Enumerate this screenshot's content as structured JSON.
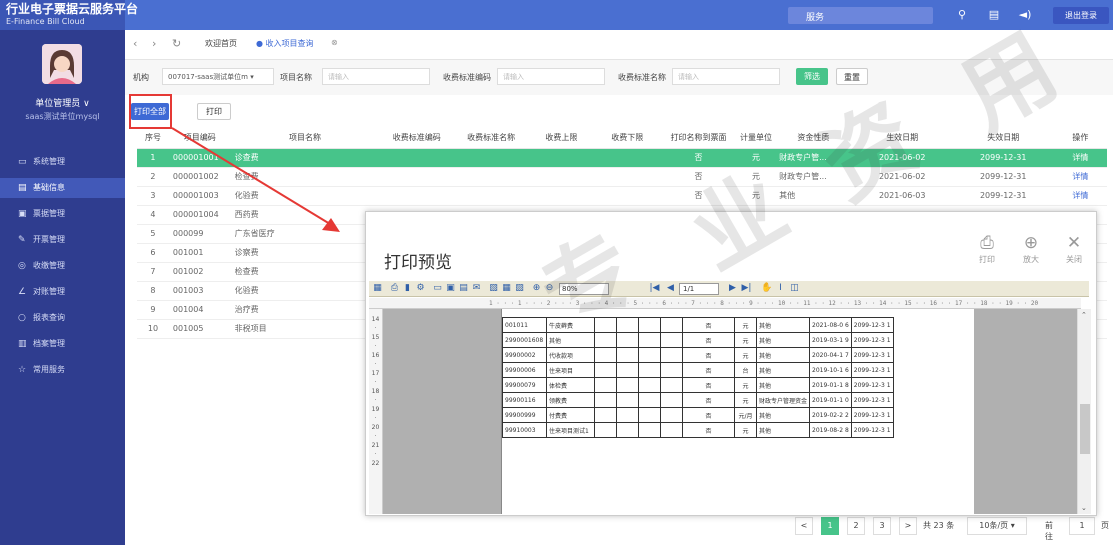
{
  "header": {
    "title": "行业电子票据云服务平台",
    "subtitle": "E-Finance Bill Cloud",
    "service_label": "服务",
    "logout": "退出登录"
  },
  "user": {
    "name": "单位管理员 ∨",
    "org": "saas测试单位mysql"
  },
  "menu": [
    {
      "icon": "▭",
      "label": "系统管理"
    },
    {
      "icon": "▤",
      "label": "基础信息"
    },
    {
      "icon": "▣",
      "label": "票据管理"
    },
    {
      "icon": "✎",
      "label": "开票管理"
    },
    {
      "icon": "◎",
      "label": "收缴管理"
    },
    {
      "icon": "∠",
      "label": "对账管理"
    },
    {
      "icon": "○",
      "label": "报表查询"
    },
    {
      "icon": "▥",
      "label": "档案管理"
    },
    {
      "icon": "☆",
      "label": "常用服务"
    }
  ],
  "tabs": {
    "home": "欢迎首页",
    "current": "● 收入项目查询",
    "close": "⊗"
  },
  "filters": {
    "org_label": "机构",
    "org_value": "007017-saas测试单位m",
    "org_arrow": "▾",
    "name_label": "项目名称",
    "name_ph": "请输入",
    "code_label": "收费标准编码",
    "code_ph": "请输入",
    "std_label": "收费标准名称",
    "std_ph": "请输入",
    "search": "筛选",
    "reset": "重置"
  },
  "actions": {
    "print_all": "打印全部",
    "print": "打印"
  },
  "table": {
    "headers": [
      "序号",
      "项目编码",
      "项目名称",
      "收费标准编码",
      "收费标准名称",
      "收费上限",
      "收费下限",
      "打印名称到票面",
      "计量单位",
      "资金性质",
      "生效日期",
      "失效日期",
      "操作"
    ],
    "rows": [
      [
        "1",
        "000001001",
        "诊查费",
        "",
        "",
        "",
        "",
        "否",
        "元",
        "财政专户管...",
        "2021-06-02",
        "2099-12-31",
        "详情"
      ],
      [
        "2",
        "000001002",
        "检查费",
        "",
        "",
        "",
        "",
        "否",
        "元",
        "财政专户管...",
        "2021-06-02",
        "2099-12-31",
        "详情"
      ],
      [
        "3",
        "000001003",
        "化验费",
        "",
        "",
        "",
        "",
        "否",
        "元",
        "其他",
        "2021-06-03",
        "2099-12-31",
        "详情"
      ],
      [
        "4",
        "000001004",
        "西药费",
        "",
        "",
        "",
        "",
        "",
        "",
        "",
        "",
        "",
        ""
      ],
      [
        "5",
        "000099",
        "广东省医疗",
        "",
        "",
        "",
        "",
        "",
        "",
        "",
        "",
        "",
        ""
      ],
      [
        "6",
        "001001",
        "诊察费",
        "",
        "",
        "",
        "",
        "",
        "",
        "",
        "",
        "",
        ""
      ],
      [
        "7",
        "001002",
        "检查费",
        "",
        "",
        "",
        "",
        "",
        "",
        "",
        "",
        "",
        ""
      ],
      [
        "8",
        "001003",
        "化验费",
        "",
        "",
        "",
        "",
        "",
        "",
        "",
        "",
        "",
        ""
      ],
      [
        "9",
        "001004",
        "治疗费",
        "",
        "",
        "",
        "",
        "",
        "",
        "",
        "",
        "",
        ""
      ],
      [
        "10",
        "001005",
        "非税项目",
        "",
        "",
        "",
        "",
        "",
        "",
        "",
        "",
        "",
        ""
      ]
    ]
  },
  "modal": {
    "title": "打印预览",
    "print": "打印",
    "zoom": "放大",
    "close": "关闭",
    "zoom_value": "80%",
    "page": "1/1",
    "ruler": "1 · · · 1 · · · 2 · · · 3 · · · 4 · · · 5 · · · 6 · · · 7 · · · 8 · · · 9 · · · 10 · · 11 · · 12 · · 13 · · 14 · · 15 · · 16 · · 17 · · 18 · · 19 · · 20",
    "vruler": [
      "14",
      "·",
      "15",
      "·",
      "16",
      "·",
      "17",
      "·",
      "18",
      "·",
      "19",
      "·",
      "20",
      "·",
      "21",
      "·",
      "22"
    ],
    "rows": [
      [
        "001011",
        "牛皮藓费",
        "",
        "",
        "",
        "",
        "否",
        "元",
        "其他",
        "2021-08-0 6",
        "2099-12-3 1"
      ],
      [
        "2990001608",
        "其他",
        "",
        "",
        "",
        "",
        "否",
        "元",
        "其他",
        "2019-03-1 9",
        "2099-12-3 1"
      ],
      [
        "99900002",
        "代收款项",
        "",
        "",
        "",
        "",
        "否",
        "元",
        "其他",
        "2020-04-1 7",
        "2099-12-3 1"
      ],
      [
        "99900006",
        "住来项目",
        "",
        "",
        "",
        "",
        "否",
        "台",
        "其他",
        "2019-10-1 6",
        "2099-12-3 1"
      ],
      [
        "99900079",
        "体检费",
        "",
        "",
        "",
        "",
        "否",
        "元",
        "其他",
        "2019-01-1 8",
        "2099-12-3 1"
      ],
      [
        "99900116",
        "领教费",
        "",
        "",
        "",
        "",
        "否",
        "元",
        "财政专户管理资金",
        "2019-01-1 0",
        "2099-12-3 1"
      ],
      [
        "99900999",
        "付费费",
        "",
        "",
        "",
        "",
        "否",
        "元/月",
        "其他",
        "2019-02-2 2",
        "2099-12-3 1"
      ],
      [
        "99910003",
        "住来项目测试1",
        "",
        "",
        "",
        "",
        "否",
        "元",
        "其他",
        "2019-08-2 8",
        "2099-12-3 1"
      ]
    ]
  },
  "pager": {
    "prev": "<",
    "pages": [
      "1",
      "2",
      "3"
    ],
    "next": ">",
    "total": "共 23 条",
    "size": "10条/页",
    "size_arrow": "▾",
    "goto": "前往",
    "goto_value": "1",
    "page_unit": "页"
  },
  "watermark": [
    "专",
    "业",
    "资",
    "用"
  ]
}
